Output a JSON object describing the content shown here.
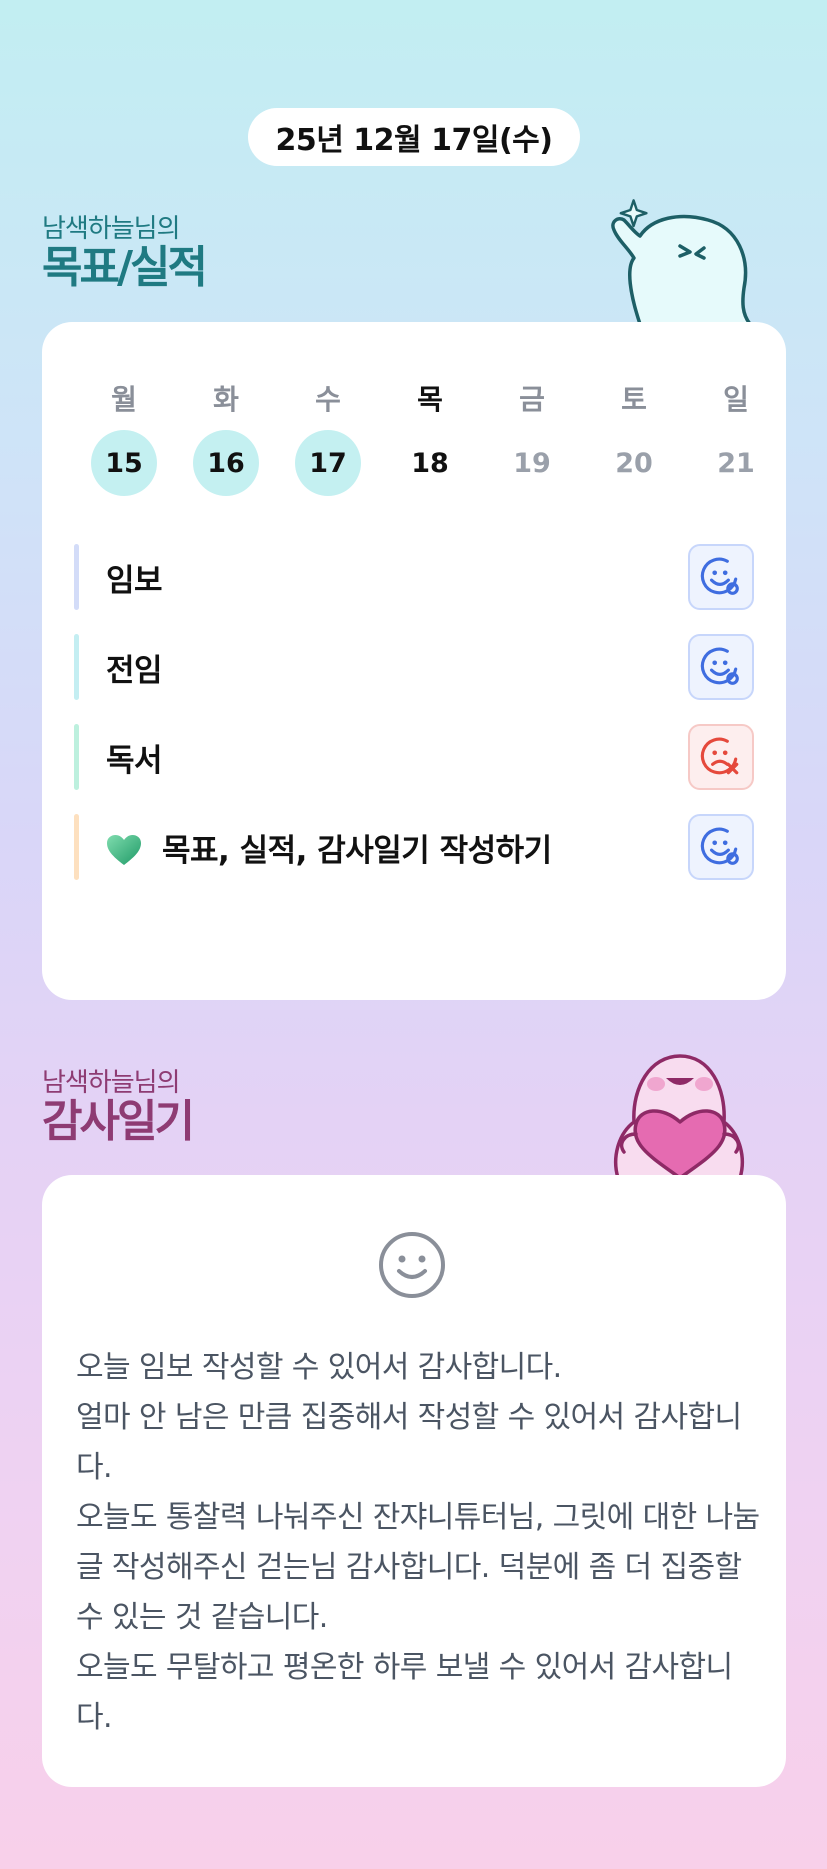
{
  "header": {
    "date": "25년 12월 17일(수)"
  },
  "goals_section": {
    "subtitle": "남색하늘님의",
    "title": "목표/실적"
  },
  "week": {
    "days": [
      {
        "dow": "월",
        "num": "15",
        "state": "done"
      },
      {
        "dow": "화",
        "num": "16",
        "state": "done"
      },
      {
        "dow": "수",
        "num": "17",
        "state": "done"
      },
      {
        "dow": "목",
        "num": "18",
        "state": "today"
      },
      {
        "dow": "금",
        "num": "19",
        "state": "future"
      },
      {
        "dow": "토",
        "num": "20",
        "state": "future"
      },
      {
        "dow": "일",
        "num": "21",
        "state": "future"
      }
    ]
  },
  "goals": [
    {
      "label": "임보",
      "bar_color": "#d3dcf8",
      "status": "achieved"
    },
    {
      "label": "전임",
      "bar_color": "#c4eef2",
      "status": "achieved"
    },
    {
      "label": "독서",
      "bar_color": "#bdf0de",
      "status": "missed"
    },
    {
      "label": "목표, 실적, 감사일기 작성하기",
      "bar_color": "#fde0bf",
      "status": "achieved",
      "icon": "green-heart-icon"
    }
  ],
  "thanks_section": {
    "subtitle": "남색하늘님의",
    "title": "감사일기"
  },
  "thanks": {
    "icon": "smile-icon",
    "paragraphs": [
      "오늘 임보 작성할 수 있어서 감사합니다.",
      "얼마 안 남은 만큼 집중해서 작성할 수 있어서 감사합니다.",
      "오늘도 통찰력 나눠주신 잔쟈니튜터님, 그릿에 대한 나눔글 작성해주신 걷는님 감사합니다. 덕분에 좀 더 집중할 수 있는 것 같습니다.",
      "오늘도 무탈하고 평온한 하루 보낼 수 있어서 감사합니다."
    ]
  },
  "colors": {
    "goals_title": "#1f7a82",
    "thanks_title": "#8e3b73",
    "achieved": "#3f6de0",
    "missed": "#e5493c"
  }
}
